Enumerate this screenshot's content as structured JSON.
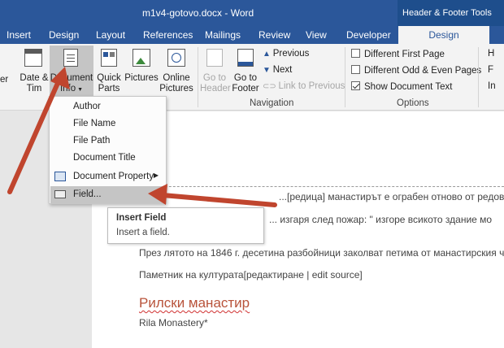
{
  "titlebar": {
    "doc_title": "m1v4-gotovo.docx - Word",
    "context_tools": "Header & Footer Tools"
  },
  "tabs": [
    "Insert",
    "Design",
    "Layout",
    "References",
    "Mailings",
    "Review",
    "View",
    "Developer",
    "Design"
  ],
  "active_tab_index": 8,
  "ribbon": {
    "left_cut_label": "er",
    "date_time": {
      "line1": "Date &",
      "line2": "Tim"
    },
    "document_info": {
      "line1": "Document",
      "line2": "Info"
    },
    "quick_parts": {
      "line1": "Quick",
      "line2": "Parts"
    },
    "pictures": "Pictures",
    "online_pictures": {
      "line1": "Online",
      "line2": "Pictures"
    },
    "go_to_header": {
      "line1": "Go to",
      "line2": "Header"
    },
    "go_to_footer": {
      "line1": "Go to",
      "line2": "Footer"
    },
    "previous": "Previous",
    "next": "Next",
    "link_to_previous": "Link to Previous",
    "navigation_label": "Navigation",
    "options": {
      "different_first_page": "Different First Page",
      "different_odd_even": "Different Odd & Even Pages",
      "show_document_text": "Show Document Text"
    },
    "options_label": "Options",
    "right_cut_1": "H",
    "right_cut_2": "F",
    "right_cut_3": "In"
  },
  "menu": {
    "items": [
      {
        "label": "Author"
      },
      {
        "label": "File Name"
      },
      {
        "label": "File Path"
      },
      {
        "label": "Document Title"
      },
      {
        "label": "Document Property"
      },
      {
        "label": "Field..."
      }
    ]
  },
  "tooltip": {
    "title": "Insert Field",
    "description": "Insert a field."
  },
  "document": {
    "header_line": "... изгаря след пожар: \" изгоре всикото здание мо",
    "line1_partial": "...[редица] манастирът е ограбен отново от редовнат",
    "line2": "През лятото на 1846 г. десетина разбойници заколват петима от манастирския ч",
    "line3": "Паметник на културата[редактиране | edit source]",
    "heading": "Рилски манастир",
    "subheading": "Rila Monastery*"
  },
  "colors": {
    "accent": "#2b579a",
    "arrow": "#c0452e",
    "heading": "#b8533a"
  }
}
